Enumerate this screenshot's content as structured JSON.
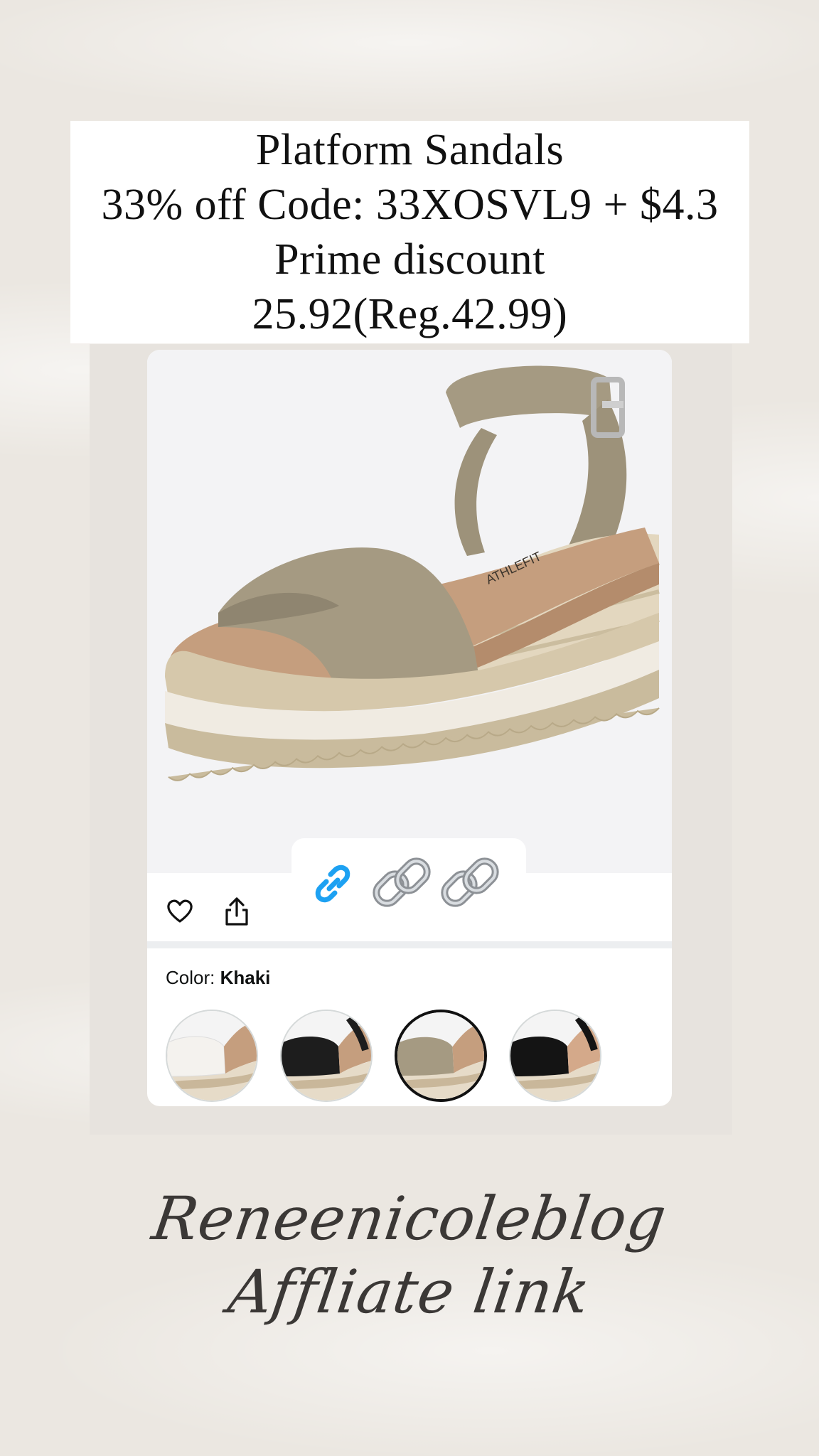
{
  "headline": {
    "line1": "Platform Sandals",
    "line2": "33% off Code: 33XOSVL9 + $4.3",
    "line3": "Prime discount",
    "line4": "25.92(Reg.42.99)"
  },
  "product": {
    "image_alt": "Khaki platform espadrille sandal with ankle strap",
    "insole_brand": "ATHLEFIT",
    "color_label": "Color: ",
    "color_value": "Khaki",
    "swatches": [
      {
        "name": "White",
        "strap_color": "#f4f2ee"
      },
      {
        "name": "Black",
        "strap_color": "#1d1d1d"
      },
      {
        "name": "Khaki",
        "strap_color": "#a59a82",
        "selected": true
      },
      {
        "name": "Black/Tan",
        "strap_color": "#141414"
      }
    ]
  },
  "icons": {
    "favorite": "heart-icon",
    "share": "share-icon",
    "link": "link-icon",
    "chain": "chain-link-icon"
  },
  "signature": {
    "line1": "Reneenicoleblog",
    "line2": "Affliate link"
  },
  "colors": {
    "link_blue": "#1da1f2",
    "khaki": "#a59a82"
  }
}
